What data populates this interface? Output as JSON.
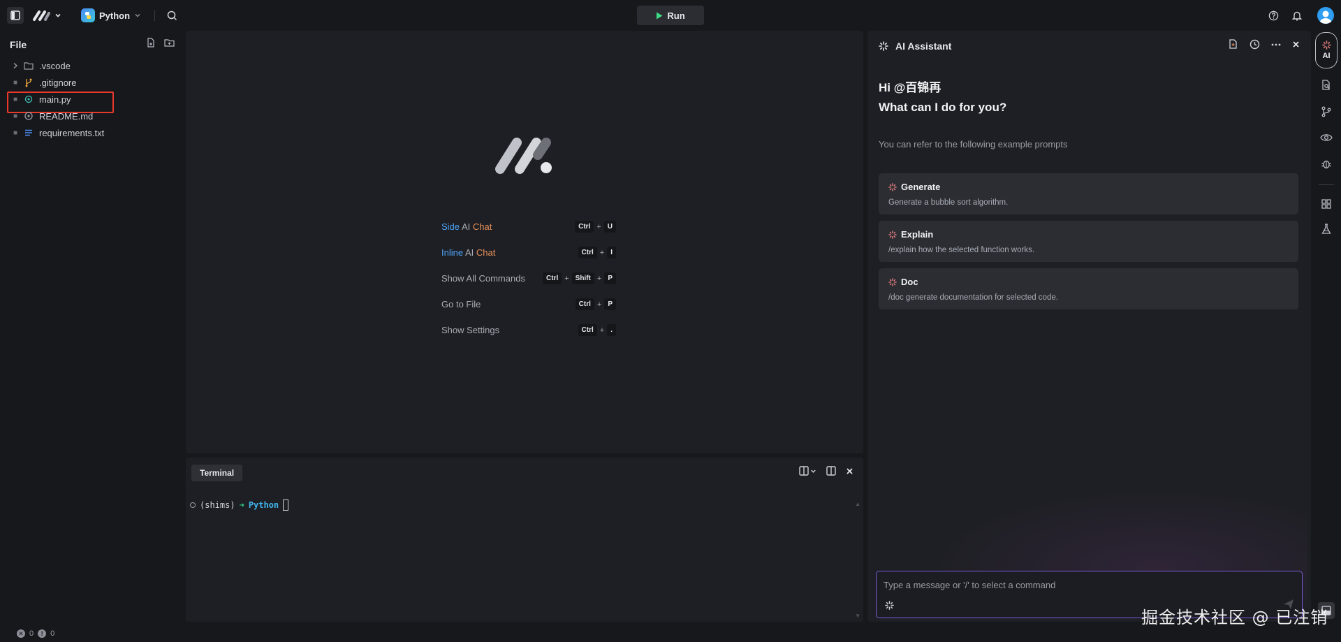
{
  "topbar": {
    "language": "Python",
    "run_label": "Run"
  },
  "files": {
    "header": "File",
    "items": [
      {
        "name": ".vscode",
        "icon": "folder-icon"
      },
      {
        "name": ".gitignore",
        "icon": "git-branch-icon"
      },
      {
        "name": "main.py",
        "icon": "python-file-icon",
        "selected": true
      },
      {
        "name": "README.md",
        "icon": "info-icon"
      },
      {
        "name": "requirements.txt",
        "icon": "text-lines-icon"
      }
    ]
  },
  "welcome": {
    "shortcuts": [
      {
        "w1": "Side",
        "w2": "AI",
        "w3": "Chat",
        "keys": [
          "Ctrl",
          "U"
        ]
      },
      {
        "w1": "Inline",
        "w2": "AI",
        "w3": "Chat",
        "keys": [
          "Ctrl",
          "I"
        ]
      },
      {
        "label": "Show All Commands",
        "keys": [
          "Ctrl",
          "Shift",
          "P"
        ]
      },
      {
        "label": "Go to File",
        "keys": [
          "Ctrl",
          "P"
        ]
      },
      {
        "label": "Show Settings",
        "keys": [
          "Ctrl",
          "."
        ]
      }
    ]
  },
  "terminal": {
    "tab": "Terminal",
    "env": "(shims)",
    "arrow": "➜",
    "cwd": "Python"
  },
  "ai": {
    "title": "AI Assistant",
    "greeting_line1": "Hi @百锦再",
    "greeting_line2": "What can I do for you?",
    "refer": "You can refer to the following example prompts",
    "prompts": [
      {
        "title": "Generate",
        "desc": "Generate a bubble sort algorithm."
      },
      {
        "title": "Explain",
        "desc": "/explain how the selected function works."
      },
      {
        "title": "Doc",
        "desc": "/doc generate documentation for selected code."
      }
    ],
    "input_placeholder": "Type a message or '/' to select a command"
  },
  "rail": {
    "ai_label": "AI"
  },
  "status": {
    "errors": "0",
    "warnings": "0"
  },
  "watermark": "掘金技术社区 @ 已注销",
  "colors": {
    "accent_blue": "#4fa3f7",
    "selection_red": "#e8382b",
    "terminal_green": "#2fd08a",
    "input_border": "#7c5bd8"
  }
}
